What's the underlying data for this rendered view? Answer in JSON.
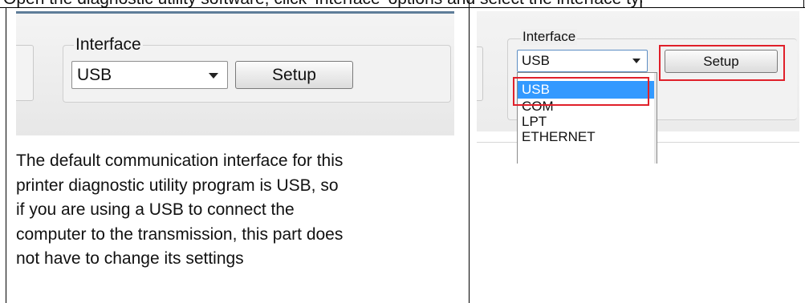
{
  "clipped_header": "Open the diagnostic utility software, click 'Interface' options and select the interface type (in the default",
  "left_screenshot": {
    "group_label": "Interface",
    "combo_value": "USB",
    "button_label": "Setup"
  },
  "paragraph_lines": [
    "The default communication interface for this",
    "printer diagnostic utility program is USB, so",
    "if you are using a USB to connect the",
    "computer to the transmission, this part does",
    "not have to change its settings"
  ],
  "right_screenshot": {
    "group_label": "Interface",
    "combo_value": "USB",
    "button_label": "Setup",
    "options": [
      "USB",
      "COM",
      "LPT",
      "ETHERNET"
    ],
    "selected_option": "USB",
    "highlight_color": "#e0202a",
    "selection_color": "#3399ff"
  }
}
